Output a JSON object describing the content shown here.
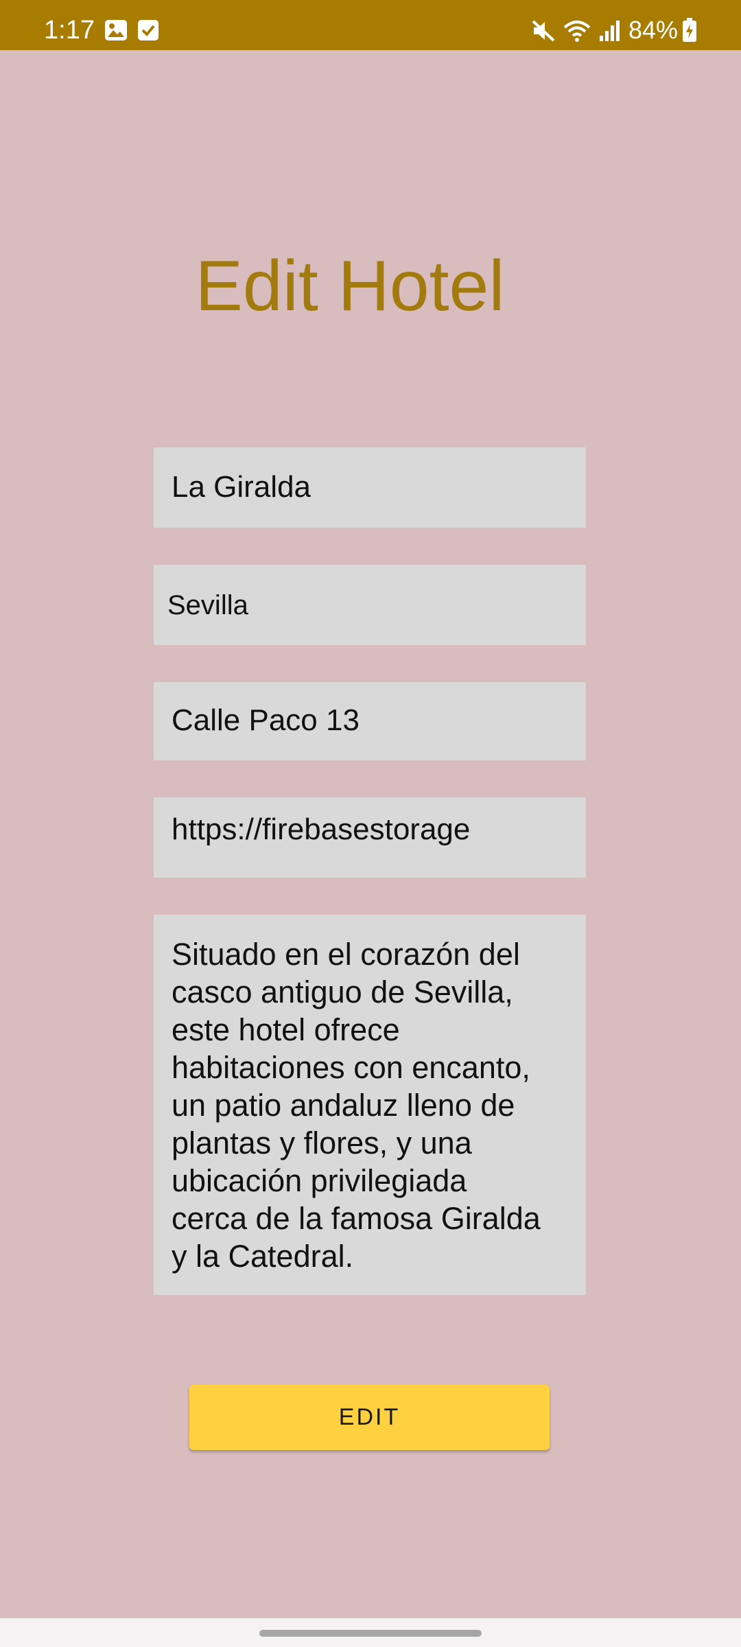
{
  "status_bar": {
    "time": "1:17",
    "battery": "84%",
    "icons": [
      "image-icon",
      "check-icon",
      "mute-icon",
      "wifi-icon",
      "signal-icon",
      "battery-charging-icon"
    ],
    "color": "#a77c00"
  },
  "title": "Edit Hotel",
  "form": {
    "name": "La Giralda",
    "city": "Sevilla",
    "address": "Calle Paco 13",
    "image_url": "https://firebasestorage",
    "description": "Situado en el corazón del\ncasco antiguo de Sevilla,\neste hotel ofrece\nhabitaciones con encanto,\nun patio andaluz lleno de\nplantas y flores, y una\nubicación privilegiada\ncerca de la famosa Giralda\ny la Catedral."
  },
  "edit_button_label": "EDIT",
  "colors": {
    "background": "#d9bcbe",
    "accent": "#a37a0d",
    "button": "#ffd03f",
    "field": "#d9d9d9"
  }
}
